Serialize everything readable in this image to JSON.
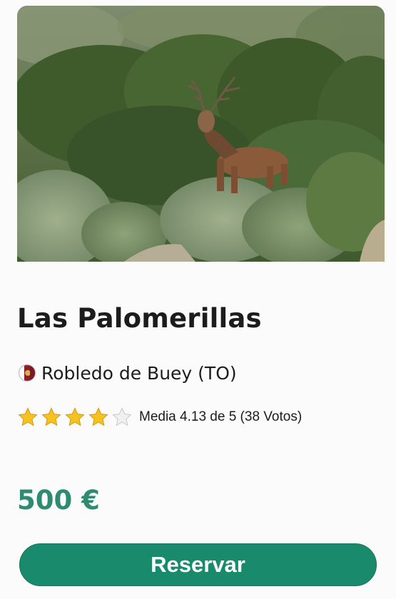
{
  "listing": {
    "image_alt": "deer-photo",
    "title": "Las Palomerillas",
    "location": {
      "flag_icon": "toledo-flag-icon",
      "text": "Robledo de Buey (TO)"
    },
    "rating": {
      "stars_filled": 4,
      "stars_total": 5,
      "average": 4.13,
      "text": "Media 4.13 de 5 (38 Votos)"
    },
    "price": "500 €",
    "reserve_label": "Reservar"
  },
  "colors": {
    "accent": "#1a8a6c",
    "price": "#2f8a72",
    "star_filled": "#f5c220",
    "star_empty": "#e6e6e6"
  }
}
